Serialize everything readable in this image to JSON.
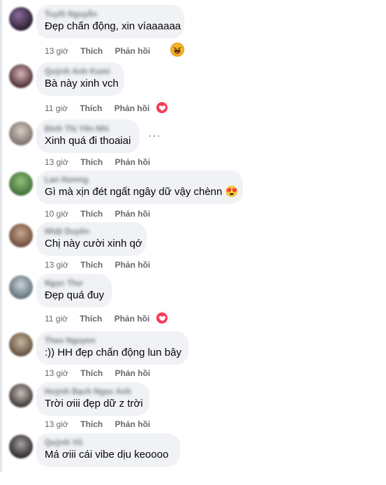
{
  "comments": [
    {
      "author": "Tuyết Nguyễn",
      "text": "Đẹp chấn động, xin víaaaaaa",
      "time": "13 giờ",
      "like": "Thích",
      "reply": "Phản hồi",
      "reaction": "haha"
    },
    {
      "author": "Quỳnh Anh Kumi",
      "text": "Bà này xinh vch",
      "time": "11 giờ",
      "like": "Thích",
      "reply": "Phản hồi",
      "reaction": "love"
    },
    {
      "author": "Đinh Thị Yến Nhi",
      "text": "Xinh quá đi thoaiai",
      "time": "13 giờ",
      "like": "Thích",
      "reply": "Phản hồi",
      "reaction": ""
    },
    {
      "author": "Lan Hương",
      "text": "Gì mà xịn đét ngất ngây dữ vậy chènn 😍",
      "time": "10 giờ",
      "like": "Thích",
      "reply": "Phản hồi",
      "reaction": ""
    },
    {
      "author": "Nhật Duyên",
      "text": "Chị này cười xinh qớ",
      "time": "13 giờ",
      "like": "Thích",
      "reply": "Phản hồi",
      "reaction": ""
    },
    {
      "author": "Ngọc Thư",
      "text": "Đẹp quá đuy",
      "time": "11 giờ",
      "like": "Thích",
      "reply": "Phản hồi",
      "reaction": "love"
    },
    {
      "author": "Thao Nguyen",
      "text": ":)) HH đẹp chấn động lun bây",
      "time": "13 giờ",
      "like": "Thích",
      "reply": "Phản hồi",
      "reaction": ""
    },
    {
      "author": "Huỳnh Bạch Ngọc Anh",
      "text": "Trời ơiii đẹp dữ z trời",
      "time": "13 giờ",
      "like": "Thích",
      "reply": "Phản hồi",
      "reaction": ""
    },
    {
      "author": "Quỳnh Vũ",
      "text": "Má ơiii cái vibe dịu keoooo",
      "time": "",
      "like": "",
      "reply": "",
      "reaction": ""
    }
  ],
  "more_options_glyph": "···",
  "colors": {
    "bubble": "#f0f2f5",
    "meta": "#65676b",
    "love": "#f33e58",
    "haha": "#f7b125"
  }
}
